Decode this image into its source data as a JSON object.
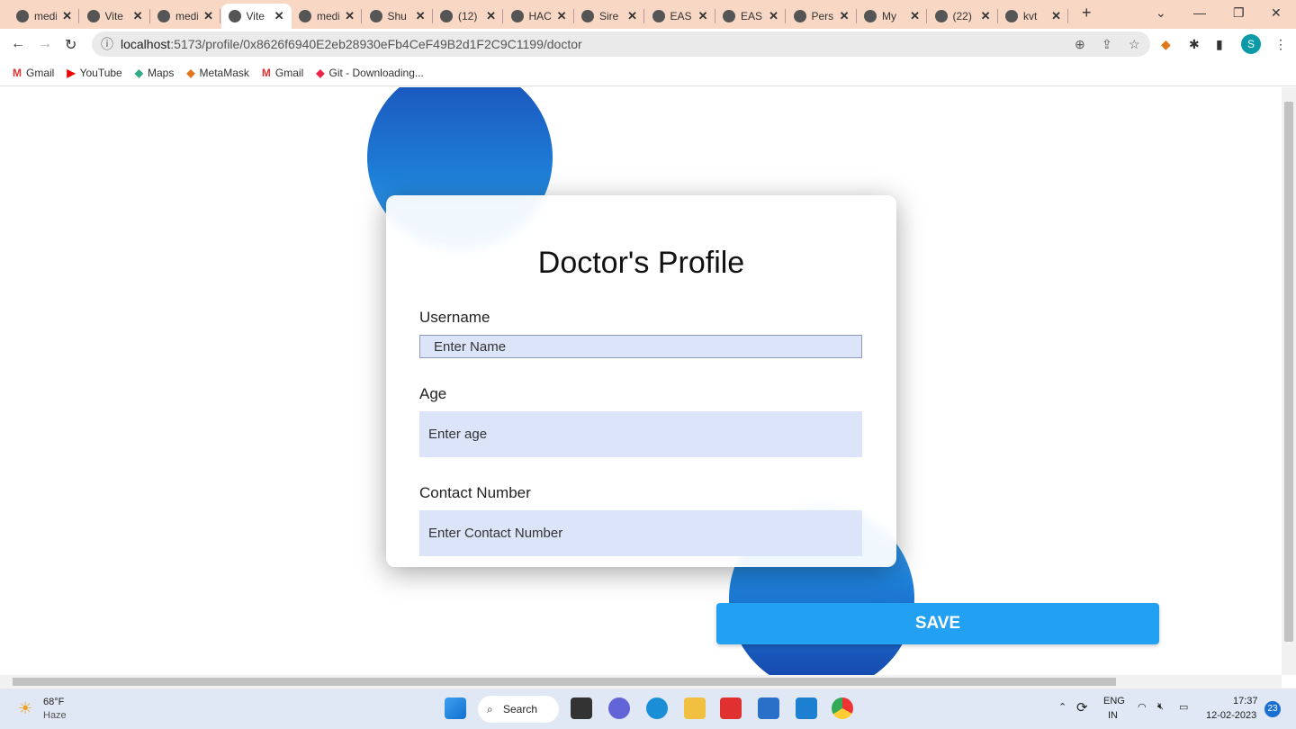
{
  "browser": {
    "tabs": [
      {
        "label": "medi",
        "icon": "globe-icon"
      },
      {
        "label": "Vite",
        "icon": "vite-icon"
      },
      {
        "label": "medi",
        "icon": "globe-icon"
      },
      {
        "label": "Vite",
        "icon": "vite-icon",
        "active": true
      },
      {
        "label": "medi",
        "icon": "globe-icon"
      },
      {
        "label": "Shu",
        "icon": "github-icon"
      },
      {
        "label": "(12)",
        "icon": "whatsapp-icon"
      },
      {
        "label": "HAC",
        "icon": "forms-icon"
      },
      {
        "label": "Sire",
        "icon": "sire-icon"
      },
      {
        "label": "EAS",
        "icon": "canva-icon"
      },
      {
        "label": "EAS",
        "icon": "globe-icon"
      },
      {
        "label": "Pers",
        "icon": "google-icon"
      },
      {
        "label": "My",
        "icon": "drive-icon"
      },
      {
        "label": "(22)",
        "icon": "linkedin-icon"
      },
      {
        "label": "kvt",
        "icon": "google-icon"
      }
    ],
    "url_host": "localhost",
    "url_path": ":5173/profile/0x8626f6940E2eb28930eFb4CeF49B2d1F2C9C1199/doctor",
    "profile_initial": "S",
    "bookmarks": [
      "Gmail",
      "YouTube",
      "Maps",
      "MetaMask",
      "Gmail",
      "Git - Downloading..."
    ]
  },
  "form": {
    "title": "Doctor's Profile",
    "username_label": "Username",
    "username_placeholder": "Enter Name",
    "age_label": "Age",
    "age_placeholder": "Enter age",
    "contact_label": "Contact Number",
    "contact_placeholder": "Enter Contact Number",
    "save_label": "SAVE"
  },
  "taskbar": {
    "temp": "68°F",
    "weather": "Haze",
    "search": "Search",
    "lang1": "ENG",
    "lang2": "IN",
    "time": "17:37",
    "date": "12-02-2023",
    "notif": "23"
  },
  "colors": {
    "accent": "#22a1f2",
    "input_bg": "#dce4fa",
    "tabbar": "#f8d7c4"
  }
}
